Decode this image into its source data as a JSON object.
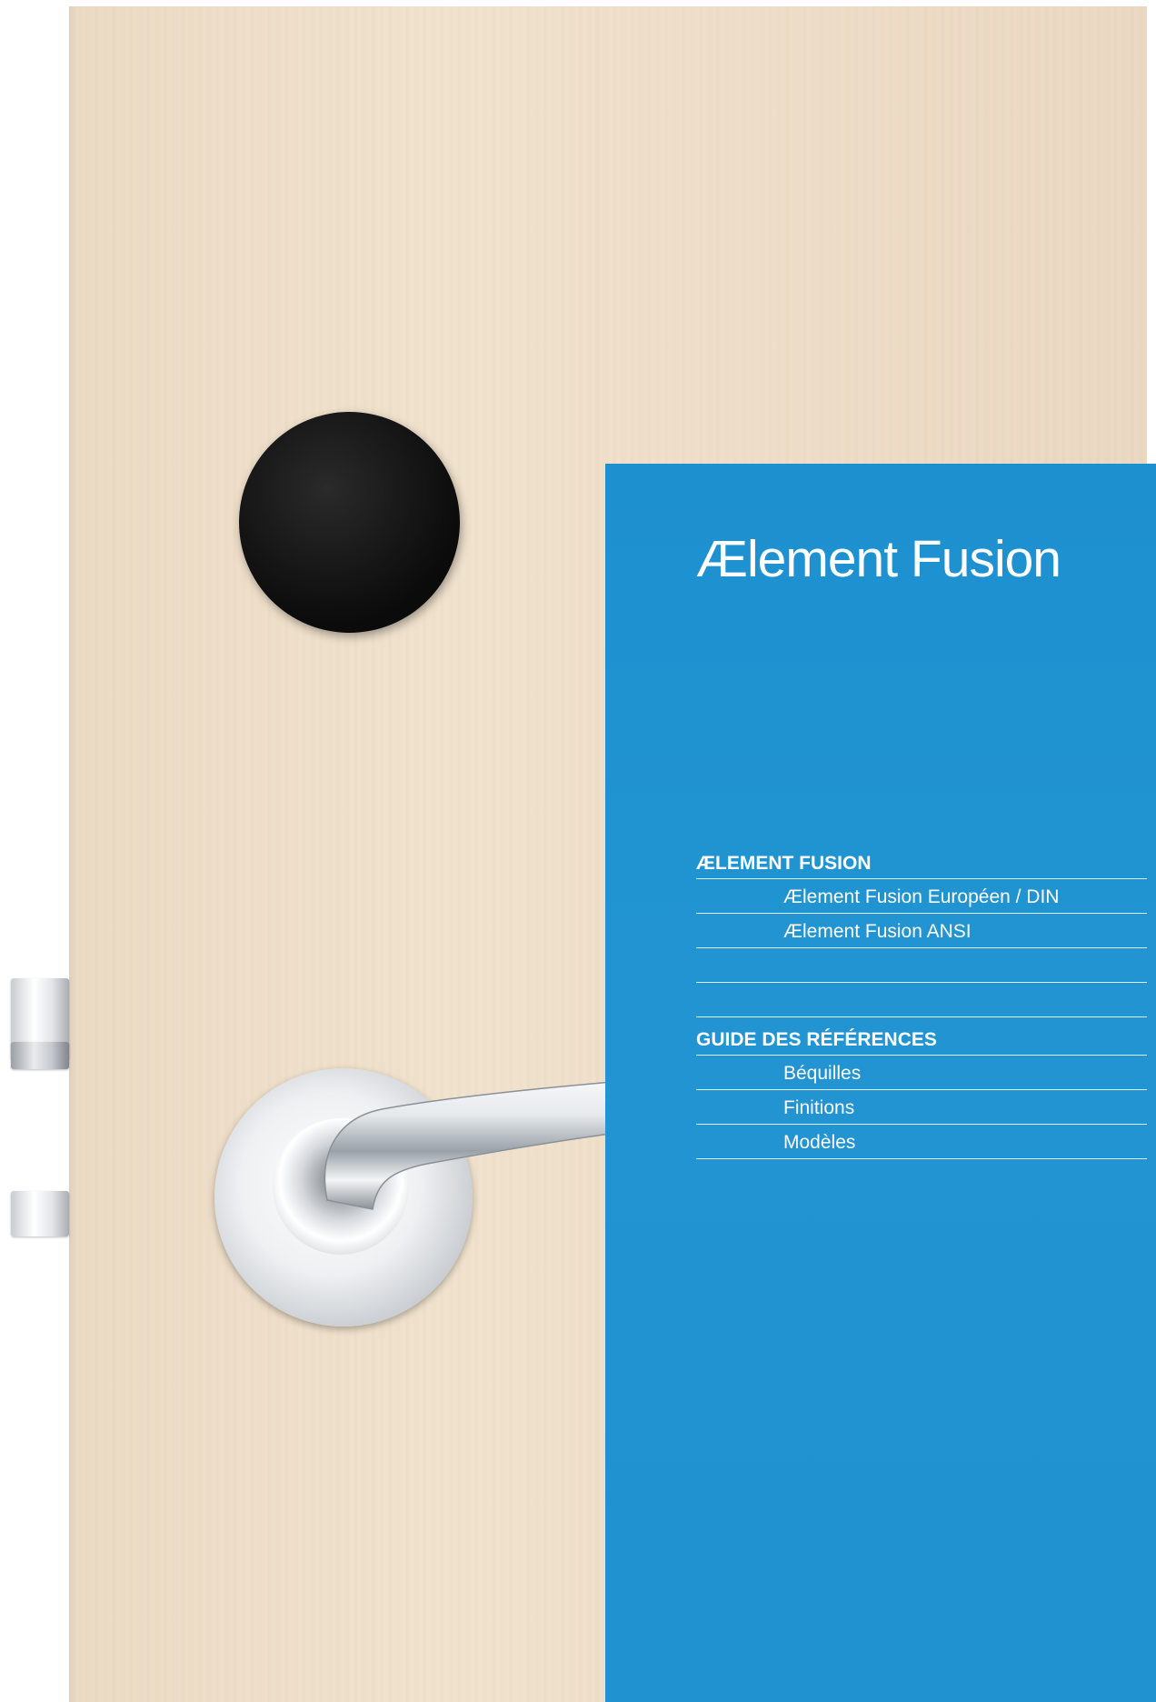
{
  "cover": {
    "title": "Ælement Fusion"
  },
  "toc": {
    "sections": [
      {
        "heading": "ÆLEMENT FUSION",
        "items": [
          "Ælement Fusion Européen / DIN",
          "Ælement Fusion ANSI"
        ]
      },
      {
        "heading": "GUIDE DES RÉFÉRENCES",
        "items": [
          "Béquilles",
          "Finitions",
          "Modèles"
        ]
      }
    ]
  },
  "colors": {
    "panel": "#2194d1",
    "text": "#ffffff",
    "door": "#efdfca",
    "reader": "#111111"
  },
  "icons": [
    "rfid-reader-icon",
    "door-lever-handle-icon",
    "door-hinge-icon"
  ]
}
